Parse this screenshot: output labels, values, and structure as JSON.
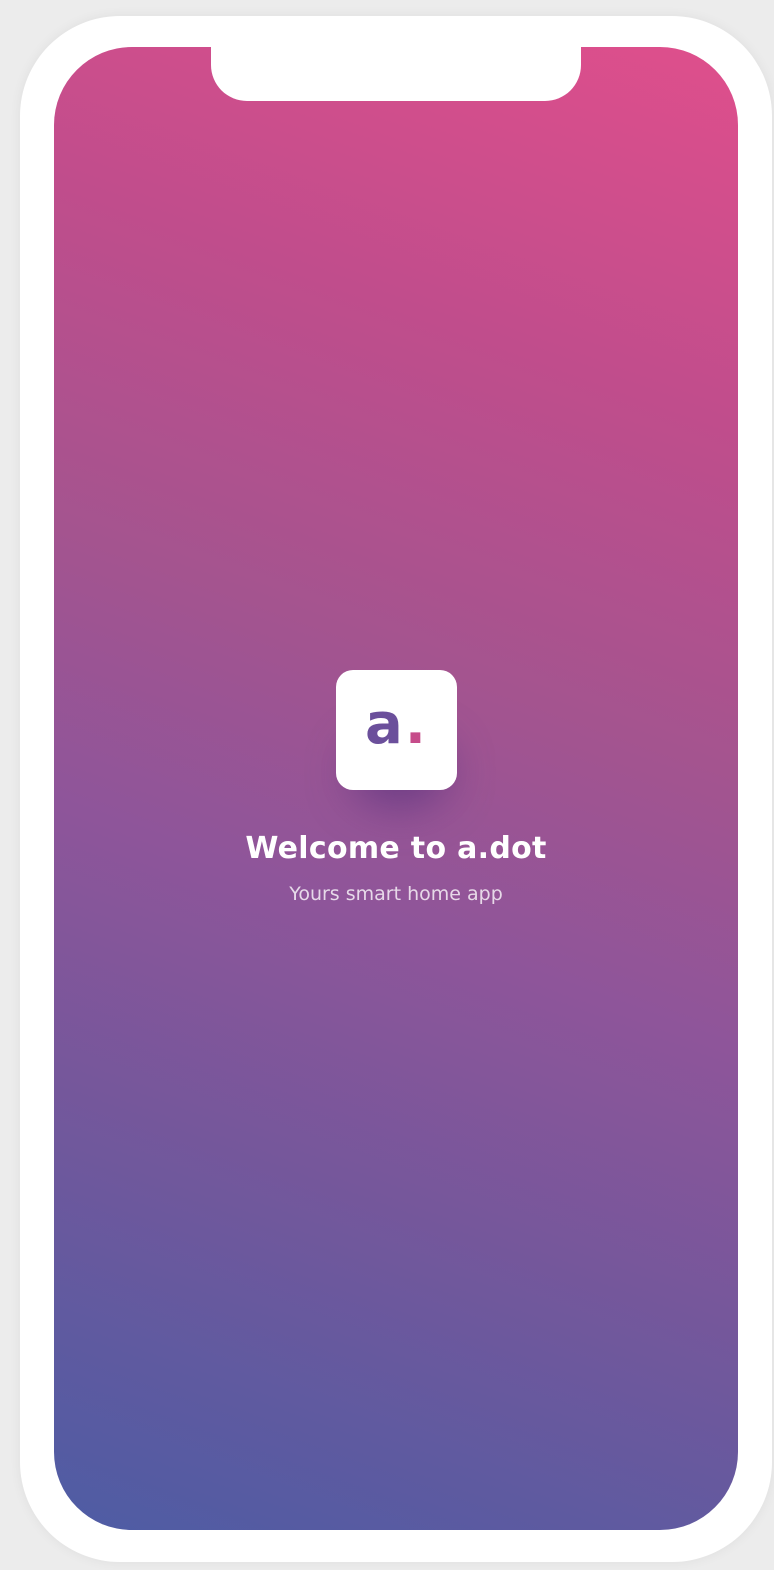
{
  "app": {
    "logo": {
      "letter": "a",
      "dot": "."
    },
    "title": "Welcome to a.dot",
    "subtitle": "Yours smart home app"
  },
  "colors": {
    "gradient_top": "#df4f8c",
    "gradient_bottom": "#4e5ca4",
    "logo_letter": "#6b4f9b",
    "logo_dot": "#c64c8a"
  }
}
